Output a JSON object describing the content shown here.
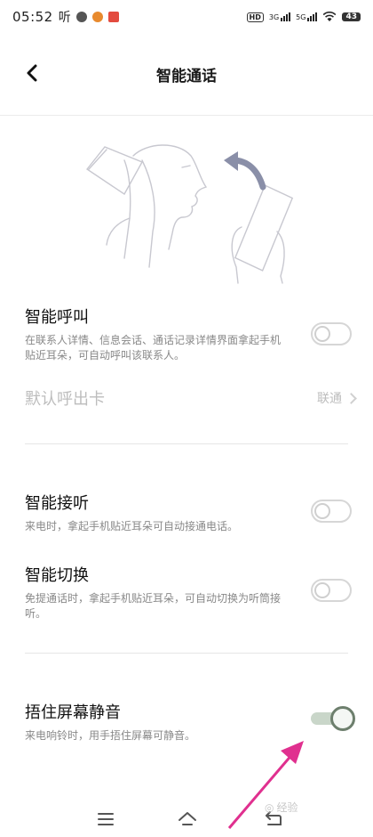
{
  "status_bar": {
    "time": "05:52",
    "app_indicator": "听",
    "network_1": "3G",
    "network_2": "5G",
    "hd_label": "HD",
    "battery": "43"
  },
  "header": {
    "title": "智能通话"
  },
  "smart_call": {
    "title": "智能呼叫",
    "description": "在联系人详情、信息会话、通话记录详情界面拿起手机贴近耳朵，可自动呼叫该联系人。",
    "enabled": false
  },
  "default_card": {
    "label": "默认呼出卡",
    "value": "联通"
  },
  "smart_answer": {
    "title": "智能接听",
    "description": "来电时，拿起手机贴近耳朵可自动接通电话。",
    "enabled": false
  },
  "smart_switch": {
    "title": "智能切换",
    "description": "免提通话时，拿起手机贴近耳朵，可自动切换为听筒接听。",
    "enabled": false
  },
  "cover_mute": {
    "title": "捂住屏幕静音",
    "description": "来电响铃时，用手捂住屏幕可静音。",
    "enabled": true
  },
  "bottom_nav": {
    "menu_icon": "menu-icon",
    "home_icon": "home-icon",
    "back_icon": "return-icon"
  },
  "watermark": {
    "text": "经验"
  },
  "colors": {
    "toggle_on_track": "#c9d6c9",
    "toggle_on_knob": "#6d7f6d",
    "annotation_arrow": "#e0308f"
  }
}
